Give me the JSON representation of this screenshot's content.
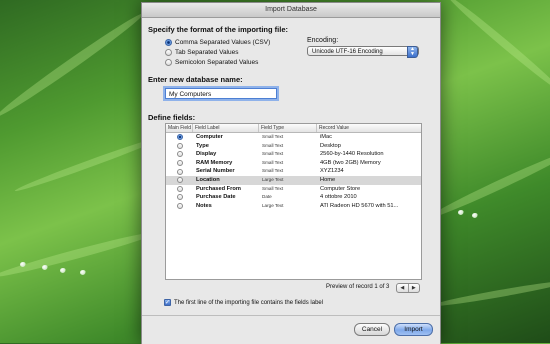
{
  "window": {
    "title": "Import Database"
  },
  "format": {
    "heading": "Specify the format of the importing file:",
    "options": [
      {
        "label": "Comma Separated Values (CSV)",
        "selected": true
      },
      {
        "label": "Tab Separated Values",
        "selected": false
      },
      {
        "label": "Semicolon Separated Values",
        "selected": false
      }
    ],
    "encoding_label": "Encoding:",
    "encoding_value": "Unicode UTF-16 Encoding"
  },
  "database": {
    "heading": "Enter new database name:",
    "name_value": "My Computers"
  },
  "fields": {
    "heading": "Define fields:",
    "columns": [
      "Main Field",
      "Field Label",
      "Field Type",
      "Record Value"
    ],
    "rows": [
      {
        "main": true,
        "label": "Computer",
        "type": "Small Text",
        "value": "iMac"
      },
      {
        "main": false,
        "label": "Type",
        "type": "Small Text",
        "value": "Desktop"
      },
      {
        "main": false,
        "label": "Display",
        "type": "Small Text",
        "value": "2560-by-1440 Resolution"
      },
      {
        "main": false,
        "label": "RAM Memory",
        "type": "Small Text",
        "value": "4GB (two 2GB) Memory"
      },
      {
        "main": false,
        "label": "Serial Number",
        "type": "Small Text",
        "value": "XYZ1234"
      },
      {
        "main": false,
        "label": "Location",
        "type": "Large Text",
        "value": "Home"
      },
      {
        "main": false,
        "label": "Purchased From",
        "type": "Small Text",
        "value": "Computer Store"
      },
      {
        "main": false,
        "label": "Purchase Date",
        "type": "Date",
        "value": "4 ottobre 2010"
      },
      {
        "main": false,
        "label": "Notes",
        "type": "Large Text",
        "value": "ATI Radeon HD 5670 with 51..."
      }
    ],
    "preview_text": "Preview of record 1 of 3"
  },
  "first_line_checkbox": {
    "label": "The first line of the importing file contains the fields label",
    "checked": true
  },
  "buttons": {
    "cancel": "Cancel",
    "import": "Import"
  }
}
